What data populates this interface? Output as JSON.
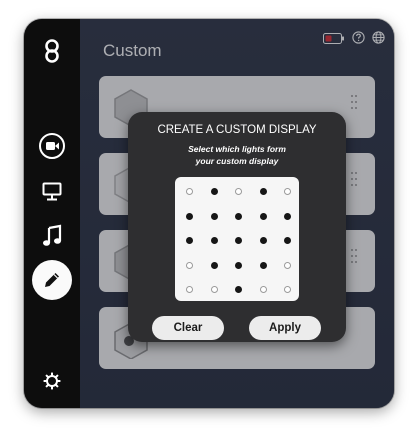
{
  "page": {
    "title": "Custom"
  },
  "sidebar": {
    "items": [
      {
        "name": "logo-icon"
      },
      {
        "name": "video-icon"
      },
      {
        "name": "monitor-icon"
      },
      {
        "name": "music-note-icon"
      },
      {
        "name": "pencil-icon",
        "active": true
      },
      {
        "name": "gear-icon"
      }
    ]
  },
  "header_icons": [
    "battery-icon",
    "help-icon",
    "globe-icon"
  ],
  "modal": {
    "title": "CREATE A CUSTOM DISPLAY",
    "subtitle_line1": "Select which lights form",
    "subtitle_line2": "your custom display",
    "grid": [
      [
        0,
        1,
        0,
        1,
        0
      ],
      [
        1,
        1,
        1,
        1,
        1
      ],
      [
        1,
        1,
        1,
        1,
        1
      ],
      [
        0,
        1,
        1,
        1,
        0
      ],
      [
        0,
        0,
        1,
        0,
        0
      ]
    ],
    "clear_label": "Clear",
    "apply_label": "Apply"
  },
  "colors": {
    "sidebar": "#0d0d0d",
    "main_bg": "#2c3344",
    "modal_bg": "#2e2e30",
    "battery_accent": "#e0323a"
  }
}
